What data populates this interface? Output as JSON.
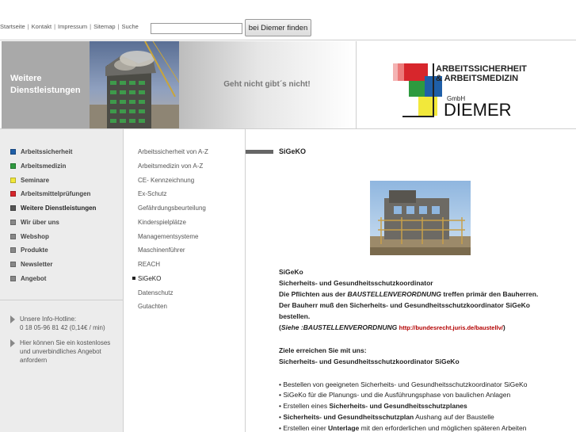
{
  "topnav": {
    "items": [
      "Startseite",
      "Kontakt",
      "Impressum",
      "Sitemap",
      "Suche"
    ],
    "separator": "|"
  },
  "search": {
    "value": "",
    "placeholder": "",
    "button_label": "bei Diemer finden"
  },
  "banner": {
    "section_title_line1": "Weitere",
    "section_title_line2": "Dienstleistungen",
    "slogan": "Geht nicht gibt´s nicht!"
  },
  "logo": {
    "line1": "ARBEITSSICHERHEIT",
    "line2": "& ARBEITSMEDIZIN",
    "gmbh": "GmbH",
    "name": "DIEMER"
  },
  "main_menu": [
    {
      "label": "Arbeitssicherheit",
      "color": "#1f5fa8"
    },
    {
      "label": "Arbeitsmedizin",
      "color": "#2e9a3f"
    },
    {
      "label": "Seminare",
      "color": "#f2e83a"
    },
    {
      "label": "Arbeitsmittelprüfungen",
      "color": "#d7262c"
    },
    {
      "label": "Weitere Dienstleistungen",
      "color": "#555555"
    },
    {
      "label": "Wir über uns",
      "color": "#888888"
    },
    {
      "label": "Webshop",
      "color": "#888888"
    },
    {
      "label": "Produkte",
      "color": "#888888"
    },
    {
      "label": "Newsletter",
      "color": "#888888"
    },
    {
      "label": "Angebot",
      "color": "#888888"
    }
  ],
  "info": {
    "hotline_label": "Unsere Info-Hotline:",
    "hotline_number": "0 18 05-96 81 42 (0,14€ / min)",
    "offer_line1": "Hier können Sie ein kostenloses",
    "offer_line2": "und unverbindliches Angebot",
    "offer_line3": "anfordern"
  },
  "sub_menu": [
    {
      "label": "Arbeitssicherheit von A-Z",
      "active": false
    },
    {
      "label": "Arbeitsmedizin von A-Z",
      "active": false
    },
    {
      "label": "CE- Kennzeichnung",
      "active": false
    },
    {
      "label": "Ex-Schutz",
      "active": false
    },
    {
      "label": "Gefährdungsbeurteilung",
      "active": false
    },
    {
      "label": "Kinderspielplätze",
      "active": false
    },
    {
      "label": "Managementsysteme",
      "active": false
    },
    {
      "label": "Maschinenführer",
      "active": false
    },
    {
      "label": "REACH",
      "active": false
    },
    {
      "label": "SiGeKO",
      "active": true
    },
    {
      "label": "Datenschutz",
      "active": false
    },
    {
      "label": "Gutachten",
      "active": false
    }
  ],
  "content": {
    "title": "SiGeKO",
    "p_sigeko": "SiGeKo",
    "p_full": "Sicherheits- und Gesundheitsschutzkoordinator",
    "p_duty_a": "Die Pflichten aus der ",
    "p_duty_b": "BAUSTELLENVERORDNUNG",
    "p_duty_c": " treffen primär den Bauherren.",
    "p_owner": "Der Bauherr muß den Sicherheits- und Gesundheitsschutzkoordinator SiGeKo",
    "p_order": "bestellen.",
    "p_see_a": "(",
    "p_see_b": "Siehe :BAUSTELLENVERORDNUNG",
    "p_see_link": "http://bundesrecht.juris.de/baustellv/",
    "p_see_c": ")",
    "p_goals": "Ziele erreichen Sie mit uns:",
    "p_goals2": "Sicherheits- und Gesundheitsschutzkoordinator SiGeKo",
    "b1": "• Bestellen von geeigneten Sicherheits- und Gesundheitsschutzkoordinator SiGeKo",
    "b2": "• SiGeKo für die Planungs- und die Ausführungsphase von baulichen Anlagen",
    "b3_a": "• Erstellen eines ",
    "b3_b": "Sicherheits- und Gesundheitsschutzplanes",
    "b4_a": "• ",
    "b4_b": "Sicherheits- und Gesundheitsschutzplan",
    "b4_c": " Aushang auf der Baustelle",
    "b5_a": "• Erstellen einer ",
    "b5_b": "Unterlage",
    "b5_c": " mit den erforderlichen und möglichen späteren Arbeiten"
  }
}
